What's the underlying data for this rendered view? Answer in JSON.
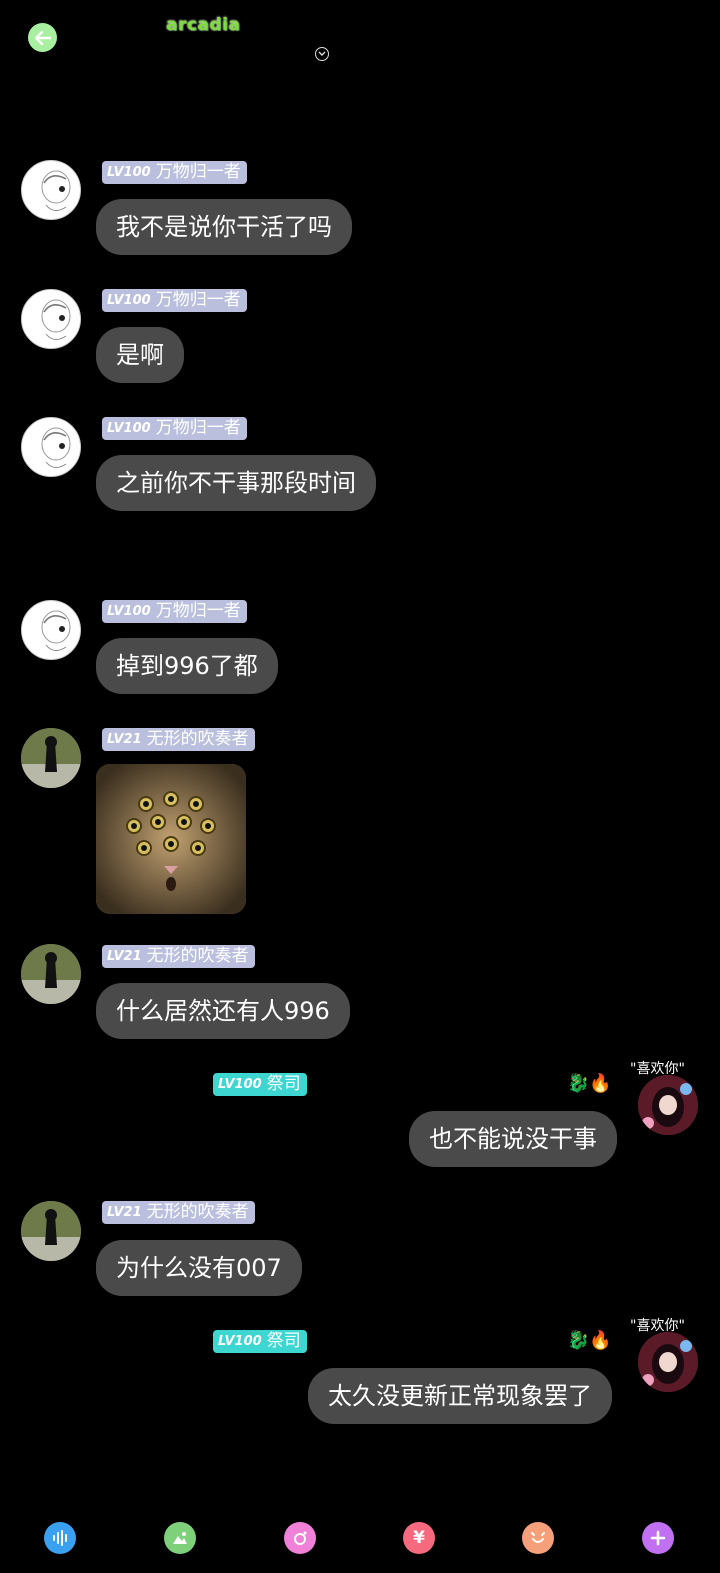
{
  "header": {
    "logo_text": "arcadia",
    "back_icon": "back-arrow-icon",
    "dropdown_icon": "chevron-down-icon",
    "accent": "#a8f0a0"
  },
  "messages": [
    {
      "level": "LV100",
      "name": "万物归一者",
      "text": "我不是说你干活了吗"
    },
    {
      "level": "LV100",
      "name": "万物归一者",
      "text": "是啊"
    },
    {
      "level": "LV100",
      "name": "万物归一者",
      "text": "之前你不干事那段时间"
    },
    {
      "level": "LV100",
      "name": "万物归一者",
      "text": "掉到996了都"
    },
    {
      "level": "LV21",
      "name": "无形的吹奏者",
      "text": ""
    },
    {
      "level": "LV21",
      "name": "无形的吹奏者",
      "text": "什么居然还有人996"
    },
    {
      "level": "LV100",
      "name": "祭司",
      "text": "也不能说没干事"
    },
    {
      "level": "LV21",
      "name": "无形的吹奏者",
      "text": "为什么没有007"
    },
    {
      "level": "LV100",
      "name": "祭司",
      "text": "太久没更新正常现象罢了"
    }
  ],
  "self_avatar_caption": "\"喜欢你\"",
  "toolbar": [
    {
      "icon": "voice-icon",
      "color": "#3aa0f0"
    },
    {
      "icon": "image-icon",
      "color": "#7ed07a"
    },
    {
      "icon": "camera-icon",
      "color": "#f080d8"
    },
    {
      "icon": "yen-icon",
      "color": "#f56a7e"
    },
    {
      "icon": "emoji-icon",
      "color": "#f5a07a"
    },
    {
      "icon": "plus-icon",
      "color": "#c070f0"
    }
  ]
}
